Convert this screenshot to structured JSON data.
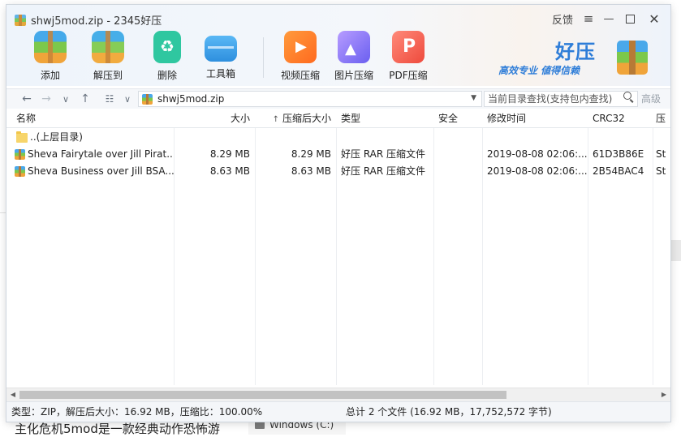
{
  "window": {
    "title": "shwj5mod.zip - 2345好压",
    "feedback_label": "反馈",
    "menu_icon": "hamburger-icon",
    "min_icon": "minimize-icon",
    "max_icon": "maximize-icon",
    "close_icon": "close-icon"
  },
  "toolbar": {
    "add": "添加",
    "extract": "解压到",
    "delete": "删除",
    "tools": "工具箱",
    "video": "视频压缩",
    "image": "图片压缩",
    "pdf": "PDF压缩"
  },
  "brand": {
    "name": "好压",
    "slogan": "高效专业 値得信赖"
  },
  "addressbar": {
    "path": "shwj5mod.zip",
    "search_placeholder": "当前目录查找(支持包内查找)",
    "advanced_label": "高级"
  },
  "table": {
    "columns": {
      "name": "名称",
      "size": "大小",
      "packed": "压缩后大小",
      "type": "类型",
      "security": "安全",
      "modified": "修改时间",
      "crc": "CRC32",
      "method": "压"
    },
    "sort_indicator": "↑",
    "parent_dir": "..(上层目录)",
    "rows": [
      {
        "name": "Sheva Fairytale over Jill Pirat...",
        "size": "8.29 MB",
        "packed": "8.29 MB",
        "type": "好压 RAR 压缩文件",
        "security": "",
        "modified": "2019-08-08 02:06:...",
        "crc": "61D3B86E",
        "method": "St"
      },
      {
        "name": "Sheva Business over Jill BSA...",
        "size": "8.63 MB",
        "packed": "8.63 MB",
        "type": "好压 RAR 压缩文件",
        "security": "",
        "modified": "2019-08-08 02:06:...",
        "crc": "2B54BAC4",
        "method": "St"
      }
    ]
  },
  "status": {
    "left": "类型：ZIP，解压后大小：16.92 MB，压缩比：100.00%",
    "right": "总计 2 个文件 (16.92 MB，17,752,572 字节)"
  },
  "background": {
    "text": "主化危机5mod是一款经典动作恐怖游",
    "drive_label": "Windows (C:)"
  }
}
